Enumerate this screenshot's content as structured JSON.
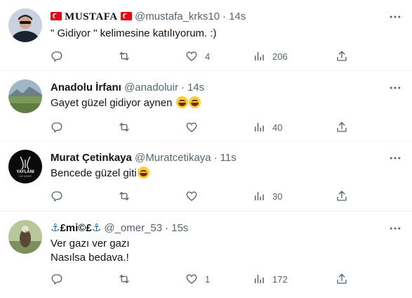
{
  "colors": {
    "text": "#0f1419",
    "muted": "#536471",
    "divider": "#eff3f4",
    "flag": "#e30a17"
  },
  "icons": {
    "reply": "reply-icon",
    "retweet": "retweet-icon",
    "like": "like-icon",
    "views": "views-icon",
    "share": "share-icon",
    "more": "more-icon"
  },
  "tweets": [
    {
      "name": "MUSTAFA",
      "handle": "@mustafa_krks10",
      "separator": "·",
      "time": "14s",
      "text": "\" Gidiyor \" kelimesine katılıyorum.  :)",
      "reply_count": "",
      "retweet_count": "",
      "like_count": "4",
      "view_count": "206"
    },
    {
      "name": "Anadolu İrfanı",
      "handle": "@anadoluir",
      "separator": "·",
      "time": "14s",
      "text": "Gayet güzel gidiyor aynen",
      "reply_count": "",
      "retweet_count": "",
      "like_count": "",
      "view_count": "40"
    },
    {
      "name": "Murat Çetinkaya",
      "handle": "@Muratcetikaya",
      "separator": "·",
      "time": "11s",
      "text": "Bencede güzel giti",
      "reply_count": "",
      "retweet_count": "",
      "like_count": "",
      "view_count": "30",
      "avatar_text_top": "YAYLANI",
      "avatar_text_bottom": "YAZ HAYATI"
    },
    {
      "name_prefix": "⚓",
      "name": "£mi©£",
      "name_suffix": "⚓",
      "handle": "@_omer_53",
      "separator": "·",
      "time": "15s",
      "text": "Ver gazı ver gazı\nNasılsa bedava.!",
      "reply_count": "",
      "retweet_count": "",
      "like_count": "1",
      "view_count": "172"
    }
  ]
}
